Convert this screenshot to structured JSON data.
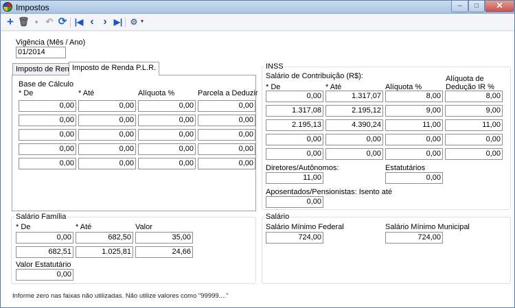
{
  "window": {
    "title": "Impostos",
    "minimize_glyph": "‒",
    "maximize_glyph": "□",
    "close_glyph": "✕"
  },
  "toolbar": {
    "icons": {
      "add": "add-icon",
      "delete": "trash-icon",
      "save": "save-icon",
      "undo": "undo-icon",
      "refresh": "refresh-icon",
      "first": "first-record-icon",
      "prev": "previous-icon",
      "next": "next-icon",
      "last": "last-record-icon",
      "tools": "tools-icon"
    },
    "glyphs": {
      "add": "+",
      "delete": "🗑",
      "save": "▪",
      "undo": "↶",
      "refresh": "⟳",
      "first": "|◀",
      "prev": "‹",
      "next": "›",
      "last": "▶|",
      "tools": "⚙",
      "drop": "▾"
    }
  },
  "vigencia": {
    "label": "Vigência  (Mês / Ano)",
    "value": "01/2014"
  },
  "tabs": [
    {
      "label": "Imposto de Renda"
    },
    {
      "label": "Imposto de Renda P.L.R."
    }
  ],
  "base_calculo": {
    "title": "Base de Cálculo",
    "headers": [
      "* De",
      "* Até",
      "Alíquota %",
      "Parcela a Deduzir"
    ],
    "rows": [
      [
        "0,00",
        "0,00",
        "0,00",
        "0,00"
      ],
      [
        "0,00",
        "0,00",
        "0,00",
        "0,00"
      ],
      [
        "0,00",
        "0,00",
        "0,00",
        "0,00"
      ],
      [
        "0,00",
        "0,00",
        "0,00",
        "0,00"
      ],
      [
        "0,00",
        "0,00",
        "0,00",
        "0,00"
      ]
    ]
  },
  "inss": {
    "title": "INSS",
    "subtitle": "Salário de Contribuição (R$):",
    "headers": [
      "* De",
      "* Até",
      "Alíquota %",
      "Alíquota de",
      "Dedução IR %"
    ],
    "rows": [
      [
        "0,00",
        "1.317,07",
        "8,00",
        "8,00"
      ],
      [
        "1.317,08",
        "2.195,12",
        "9,00",
        "9,00"
      ],
      [
        "2.195,13",
        "4.390,24",
        "11,00",
        "11,00"
      ],
      [
        "0,00",
        "0,00",
        "0,00",
        "0,00"
      ],
      [
        "0,00",
        "0,00",
        "0,00",
        "0,00"
      ]
    ],
    "diretores": {
      "label": "Diretores/Autônomos:",
      "value": "11,00"
    },
    "estatutarios": {
      "label": "Estatutários",
      "value": "0,00"
    },
    "aposentados": {
      "label": "Aposentados/Pensionistas: Isento até",
      "value": "0,00"
    }
  },
  "salario_familia": {
    "title": "Salário Família",
    "headers": [
      "* De",
      "* Até",
      "Valor"
    ],
    "rows": [
      [
        "0,00",
        "682,50",
        "35,00"
      ],
      [
        "682,51",
        "1.025,81",
        "24,66"
      ]
    ],
    "estatutario": {
      "label": "Valor Estatutário",
      "value": "0,00"
    }
  },
  "salario": {
    "title": "Salário",
    "federal": {
      "label": "Salário Mínimo Federal",
      "value": "724,00"
    },
    "municipal": {
      "label": "Salário Mínimo Municipal",
      "value": "724,00"
    }
  },
  "footer": {
    "note": "Informe zero nas faixas não utilizadas. Não utilize valores como \"99999....\""
  }
}
